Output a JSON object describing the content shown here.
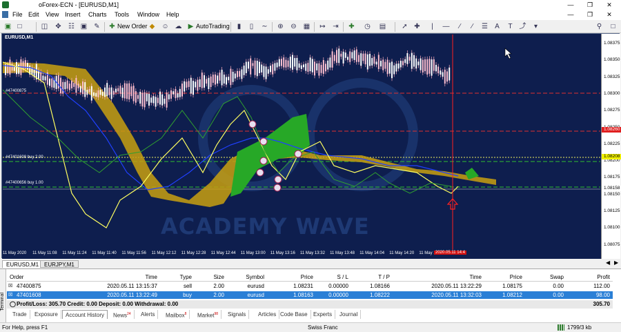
{
  "window": {
    "title": "oForex-ECN - [EURUSD,M1]"
  },
  "menu": [
    "File",
    "Edit",
    "View",
    "Insert",
    "Charts",
    "Tools",
    "Window",
    "Help"
  ],
  "toolbar": {
    "new_order": "New Order",
    "autotrading": "AutoTrading"
  },
  "chart": {
    "label": "EURUSD,M1",
    "watermark": "ACADEMY WAVE",
    "price_ticks": [
      "1.08375",
      "1.08350",
      "1.08325",
      "1.08300",
      "1.08275",
      "1.08250",
      "1.08225",
      "1.08200",
      "1.08175",
      "1.08150",
      "1.08125",
      "1.08100",
      "1.08075"
    ],
    "price_marks": [
      {
        "text": "1.08260",
        "color": "#e02020",
        "fg": "#fff"
      },
      {
        "text": "1.08208",
        "color": "#f0f000",
        "fg": "#000"
      },
      {
        "text": "1.08158",
        "color": "#ffffff",
        "fg": "#000"
      }
    ],
    "time_ticks": [
      "11 May 2020",
      "11 May 11:08",
      "11 May 11:24",
      "11 May 11:40",
      "11 May 11:56",
      "11 May 12:12",
      "11 May 12:28",
      "11 May 12:44",
      "11 May 13:00",
      "11 May 13:16",
      "11 May 13:32",
      "11 May 13:48",
      "11 May 14:04",
      "11 May 14:20",
      "11 May 14:3"
    ],
    "cursor_time": "2020.05.11 14:4",
    "order_labels": [
      "#47400875",
      "#47401608 buy 2.00",
      "#47400656 buy 1.00"
    ]
  },
  "chart_tabs": [
    "EURUSD,M1",
    "EURJPY,M1"
  ],
  "terminal": {
    "columns": [
      "Order",
      "Time",
      "Type",
      "Size",
      "Symbol",
      "Price",
      "S / L",
      "T / P",
      "Time",
      "Price",
      "Swap",
      "Profit"
    ],
    "rows": [
      [
        "47400875",
        "2020.05.11 13:15:37",
        "sell",
        "2.00",
        "eurusd",
        "1.08231",
        "0.00000",
        "1.08166",
        "2020.05.11 13:22:29",
        "1.08175",
        "0.00",
        "112.00"
      ],
      [
        "47401608",
        "2020.05.11 13:22:49",
        "buy",
        "2.00",
        "eurusd",
        "1.08163",
        "0.00000",
        "1.08222",
        "2020.05.11 13:32:03",
        "1.08212",
        "0.00",
        "98.00"
      ]
    ],
    "summary": "Profit/Loss: 305.70  Credit: 0.00  Deposit: 0.00  Withdrawal: 0.00",
    "summary_total": "305.70",
    "side_label": "Terminal",
    "tabs": [
      {
        "label": "Trade",
        "badge": ""
      },
      {
        "label": "Exposure",
        "badge": ""
      },
      {
        "label": "Account History",
        "badge": ""
      },
      {
        "label": "News",
        "badge": "24"
      },
      {
        "label": "Alerts",
        "badge": ""
      },
      {
        "label": "Mailbox",
        "badge": "8"
      },
      {
        "label": "Market",
        "badge": "98"
      },
      {
        "label": "Signals",
        "badge": ""
      },
      {
        "label": "Articles",
        "badge": ""
      },
      {
        "label": "Code Base",
        "badge": ""
      },
      {
        "label": "Experts",
        "badge": ""
      },
      {
        "label": "Journal",
        "badge": ""
      }
    ]
  },
  "status": {
    "help": "For Help, press F1",
    "profile": "Swiss Franc",
    "traffic": "1799/3 kb"
  }
}
